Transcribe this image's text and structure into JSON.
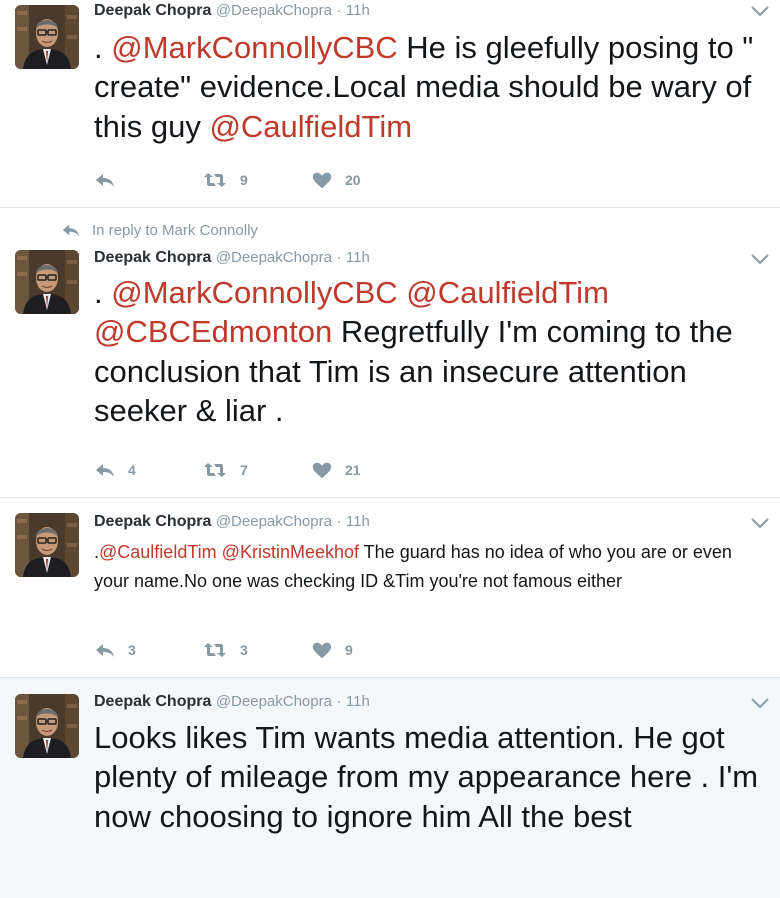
{
  "tweets": [
    {
      "name": "Deepak Chopra",
      "handle": "@DeepakChopra",
      "sep": "·",
      "time": "11h",
      "segments": [
        {
          "t": ". "
        },
        {
          "t": "@MarkConnollyCBC",
          "mention": true
        },
        {
          "t": " He is gleefully posing to \" create\" evidence.Local media should be wary of this guy "
        },
        {
          "t": "@CaulfieldTim",
          "mention": true
        }
      ],
      "reply_count": "",
      "retweet_count": "9",
      "like_count": "20"
    },
    {
      "reply_context": "In reply to Mark Connolly",
      "name": "Deepak Chopra",
      "handle": "@DeepakChopra",
      "sep": "·",
      "time": "11h",
      "segments": [
        {
          "t": ". "
        },
        {
          "t": "@MarkConnollyCBC",
          "mention": true
        },
        {
          "t": " "
        },
        {
          "t": "@CaulfieldTim",
          "mention": true
        },
        {
          "t": " "
        },
        {
          "t": "@CBCEdmonton",
          "mention": true
        },
        {
          "t": " Regretfully I'm coming to the conclusion that Tim is an insecure attention seeker & liar ."
        }
      ],
      "reply_count": "4",
      "retweet_count": "7",
      "like_count": "21"
    },
    {
      "name": "Deepak Chopra",
      "handle": "@DeepakChopra",
      "sep": "·",
      "time": "11h",
      "segments": [
        {
          "t": "."
        },
        {
          "t": "@CaulfieldTim",
          "mention": true
        },
        {
          "t": " "
        },
        {
          "t": "@KristinMeekhof",
          "mention": true
        },
        {
          "t": " The guard has no idea of who you are or even your name.No one was checking ID &Tim you're not famous either"
        }
      ],
      "reply_count": "3",
      "retweet_count": "3",
      "like_count": "9"
    },
    {
      "name": "Deepak Chopra",
      "handle": "@DeepakChopra",
      "sep": "·",
      "time": "11h",
      "segments": [
        {
          "t": "Looks likes Tim wants media attention. He got plenty of mileage from my appearance here . I'm now choosing to ignore him All the best"
        }
      ]
    }
  ],
  "icons": {
    "reply": "reply-icon",
    "retweet": "retweet-icon",
    "like": "heart-icon",
    "more": "chevron-down-icon",
    "avatar": "avatar"
  },
  "colors": {
    "mention": "#c0392b",
    "muted": "#8899a6",
    "highlight_bg": "#f5f8fa"
  }
}
